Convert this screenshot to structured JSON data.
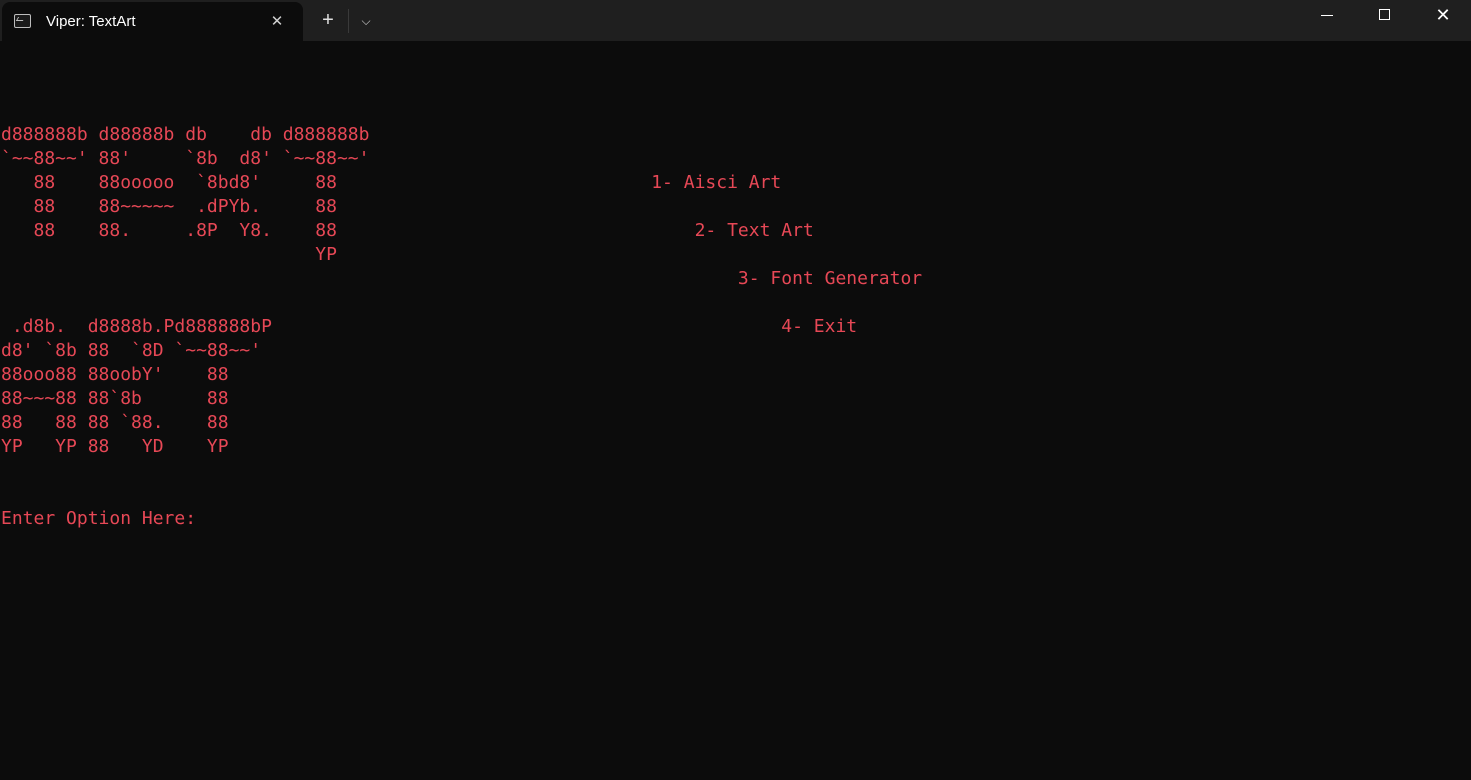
{
  "window": {
    "tab_title": "Viper: TextArt",
    "tab_icon": "terminal-icon",
    "close_tab_icon": "close-icon",
    "new_tab_icon": "plus-icon",
    "dropdown_icon": "chevron-down-icon",
    "minimize_icon": "minimize-icon",
    "maximize_icon": "maximize-icon",
    "close_window_icon": "close-icon"
  },
  "terminal": {
    "text_color": "#e74856",
    "background": "#0c0c0c",
    "lines": [
      "",
      "",
      "",
      "d888888b d88888b db    db d888888b",
      "`~~88~~' 88'     `8b  d8' `~~88~~'",
      "   88    88ooooo  `8bd8'     88                             1- Aisci Art",
      "   88    88~~~~~  .dPYb.     88",
      "   88    88.     .8P  Y8.    88                                 2- Text Art",
      "                             YP",
      "                                                                    3- Font Generator",
      "",
      " .d8b.  d8888b.Pd888888bP                                               4- Exit",
      "d8' `8b 88  `8D `~~88~~'",
      "88ooo88 88oobY'    88",
      "88~~~88 88`8b      88",
      "88   88 88 `88.    88",
      "YP   YP 88   YD    YP",
      "",
      "",
      "Enter Option Here:"
    ]
  }
}
